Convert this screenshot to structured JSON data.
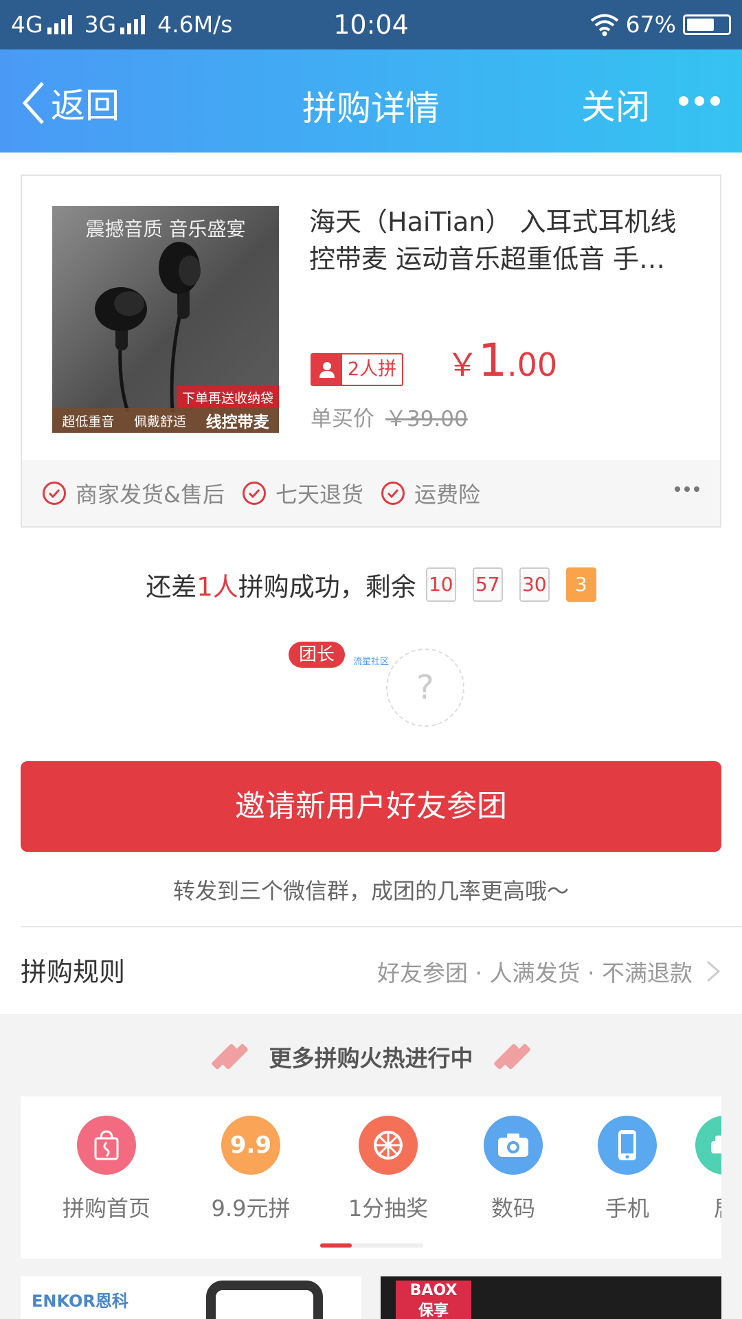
{
  "status": {
    "net1": "4G",
    "net2": "3G",
    "speed": "4.6M/s",
    "time": "10:04",
    "battery": "67%",
    "battery_level": 0.67
  },
  "nav": {
    "back": "返回",
    "title": "拼购详情",
    "close": "关闭"
  },
  "product": {
    "image_caption_top": "震撼音质  音乐盛宴",
    "image_ribbon": "下单再送收纳袋",
    "image_tag1": "超低重音",
    "image_tag2": "佩戴舒适",
    "image_tag3": "线控带麦",
    "title": "海天（HaiTian） 入耳式耳机线控带麦 运动音乐超重低音 手…",
    "group_badge": "2人拼",
    "price_symbol": "￥",
    "price_int": "1",
    "price_dec": ".00",
    "single_label": "单买价",
    "single_price": "￥39.00"
  },
  "features": [
    "商家发货&售后",
    "七天退货",
    "运费险"
  ],
  "countdown": {
    "prefix": "还差",
    "count": "1人",
    "suffix": "拼购成功，剩余",
    "hours": "10",
    "minutes": "57",
    "seconds": "30",
    "tenths": "3"
  },
  "group": {
    "leader_badge": "团长",
    "leader_name": "流星社区",
    "empty_slot": "?"
  },
  "invite": {
    "button": "邀请新用户好友参团",
    "hint": "转发到三个微信群，成团的几率更高哦～"
  },
  "rules": {
    "title": "拼购规则",
    "summary": "好友参团 · 人满发货 · 不满退款"
  },
  "more": {
    "title": "更多拼购火热进行中",
    "categories": [
      {
        "label": "拼购首页",
        "icon": "shopping-bag-icon",
        "color": "#f36b80"
      },
      {
        "label": "9.9元拼",
        "icon": "nine-nine-icon",
        "color": "#f9a456"
      },
      {
        "label": "1分抽奖",
        "icon": "prize-wheel-icon",
        "color": "#f47158"
      },
      {
        "label": "数码",
        "icon": "camera-icon",
        "color": "#5ba6ee"
      },
      {
        "label": "手机",
        "icon": "phone-icon",
        "color": "#5aa8f0"
      },
      {
        "label": "居",
        "icon": "sofa-icon",
        "color": "#4fd1b4"
      }
    ],
    "nine_nine_glyph": "9.9"
  },
  "tiles": {
    "left_brand": "ENKOR恩科",
    "right_brand_line1": "BAOX",
    "right_brand_line2": "保享"
  },
  "colors": {
    "accent": "#e23b41",
    "nav_gradient_start": "#4a9af5",
    "nav_gradient_end": "#35c3f2",
    "statusbar": "#2d5c8f"
  }
}
